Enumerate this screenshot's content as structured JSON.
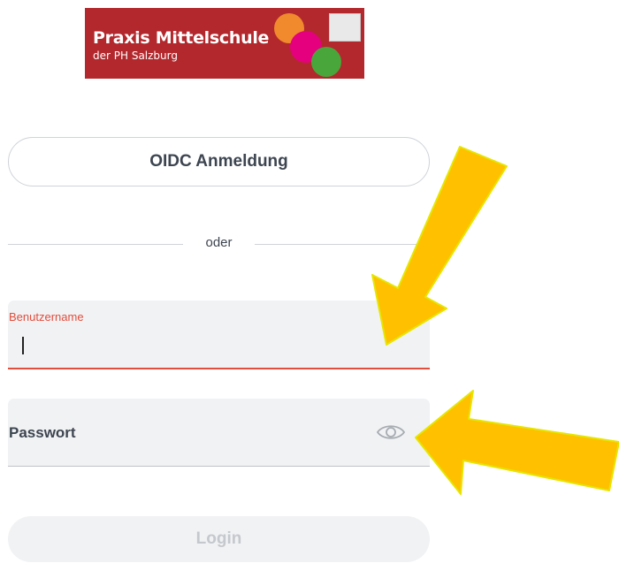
{
  "logo": {
    "title": "Praxis Mittelschule",
    "subtitle": "der PH Salzburg",
    "colors": {
      "background": "#b3282d",
      "orange": "#f08a2c",
      "magenta": "#e5007e",
      "green": "#49a63a"
    }
  },
  "oidc_button": {
    "label": "OIDC Anmeldung"
  },
  "divider": {
    "text": "oder"
  },
  "username": {
    "label": "Benutzername",
    "value": "",
    "accent": "#e24d3c"
  },
  "password": {
    "label": "Passwort",
    "value": "",
    "icon": "eye-icon"
  },
  "login_button": {
    "label": "Login",
    "disabled": true
  },
  "annotations": {
    "arrow_color": "#ffc000",
    "arrow_outline": "#e8e800"
  }
}
